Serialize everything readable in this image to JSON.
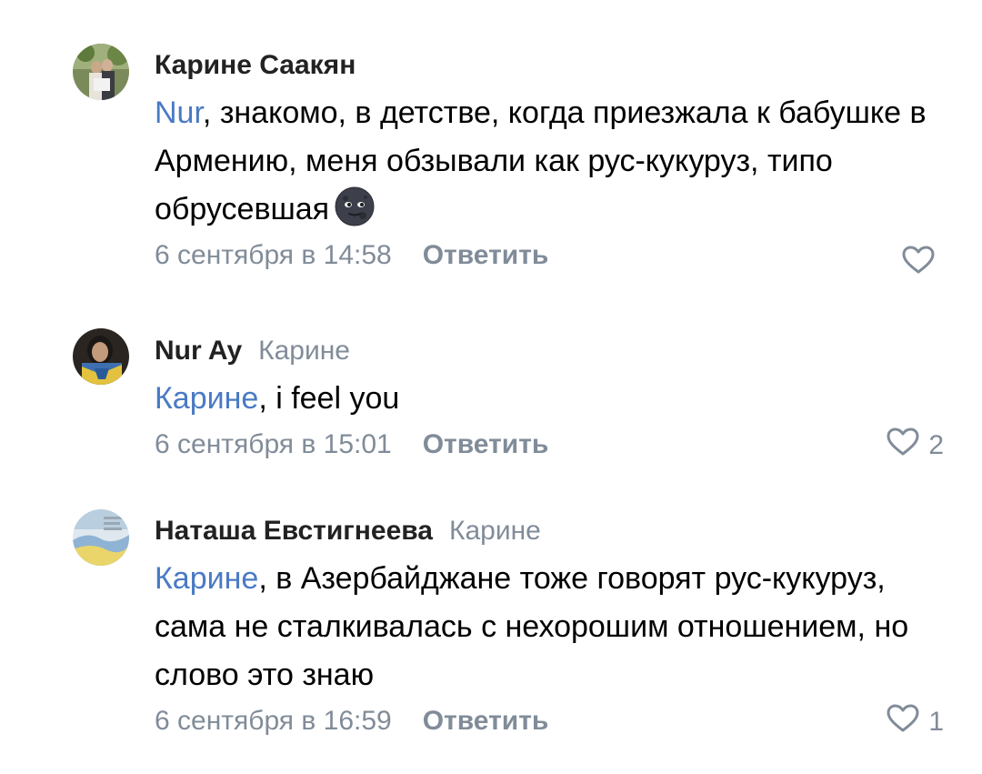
{
  "comments": [
    {
      "author": "Карине Саакян",
      "reply_to": "",
      "mention": "Nur",
      "text": ", знакомо, в детстве, когда приезжала к бабушке в Армению, меня обзывали как рус-кукуруз, типо обрусевшая",
      "emoji": "new-moon-face-emoji",
      "date": "6 сентября в 14:58",
      "reply_label": "Ответить",
      "likes": ""
    },
    {
      "author": "Nur Ay",
      "reply_to": "Карине",
      "mention": "Карине",
      "text": ", i feel you",
      "date": "6 сентября в 15:01",
      "reply_label": "Ответить",
      "likes": "2"
    },
    {
      "author": "Наташа Евстигнеева",
      "reply_to": "Карине",
      "mention": "Карине",
      "text": ", в Азербайджане тоже говорят рус-кукуруз, сама не сталкивалась с нехорошим отношением, но слово это знаю",
      "date": "6 сентября в 16:59",
      "reply_label": "Ответить",
      "likes": "1"
    }
  ],
  "colors": {
    "link": "#4a7ac4",
    "meta": "#818c99",
    "author": "#222222"
  },
  "icons": {
    "like": "heart-outline-icon"
  }
}
